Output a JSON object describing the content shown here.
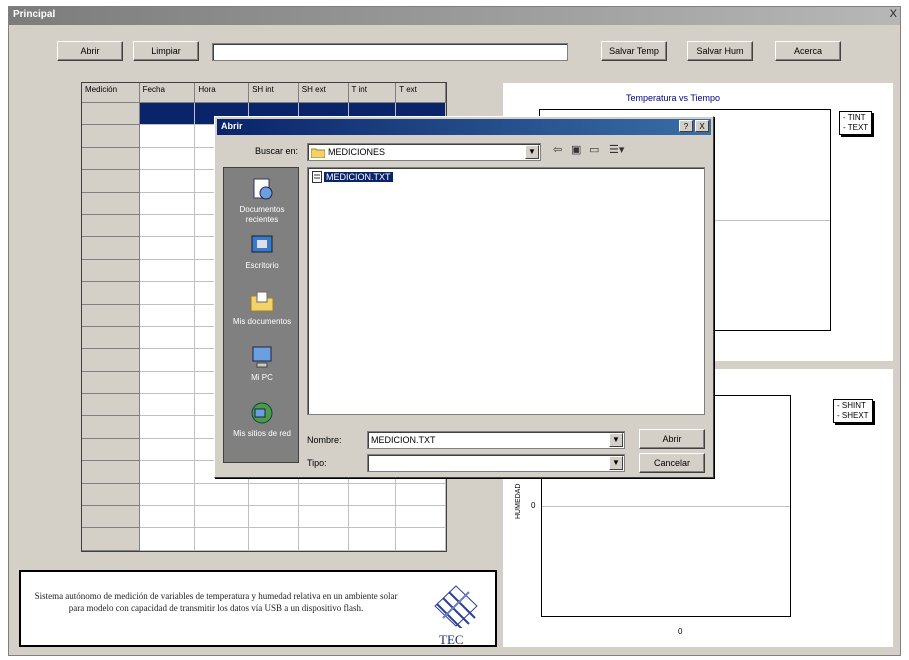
{
  "window": {
    "title": "Principal",
    "close": "X"
  },
  "toolbar": {
    "abrir": "Abrir",
    "limpiar": "Limpiar",
    "path_value": "",
    "salvar_temp": "Salvar Temp",
    "salvar_hum": "Salvar Hum",
    "acerca": "Acerca"
  },
  "table": {
    "headers": [
      "Medición",
      "Fecha",
      "Hora",
      "SH int",
      "SH ext",
      "T int",
      "T ext"
    ],
    "row_count": 20,
    "selected_row": 0
  },
  "temp_chart": {
    "title": "Temperatura vs Tiempo",
    "legend": [
      "TINT",
      "TEXT"
    ]
  },
  "hum_chart": {
    "ylabel": "HUMEDAD",
    "y_tick": "0",
    "x_tick": "0",
    "legend": [
      "SHINT",
      "SHEXT"
    ]
  },
  "description": {
    "text": "Sistema autónomo de medición de variables de temperatura y humedad relativa en un ambiente solar para modelo con capacidad de transmitir los datos vía USB a un dispositivo flash.",
    "logo_text": "TEC"
  },
  "dialog": {
    "title": "Abrir",
    "help": "?",
    "close": "X",
    "look_in_label": "Buscar en:",
    "look_in_value": "MEDICIONES",
    "places": [
      "Documentos recientes",
      "Escritorio",
      "Mis documentos",
      "Mi PC",
      "Mis sitios de red"
    ],
    "file": "MEDICION.TXT",
    "filename_label": "Nombre:",
    "filename_value": "MEDICION.TXT",
    "filetype_label": "Tipo:",
    "filetype_value": "",
    "open_btn": "Abrir",
    "cancel_btn": "Cancelar"
  },
  "colors": {
    "selection": "#0a246a",
    "title_active": "#0a246a",
    "plot_axis": "#000000"
  }
}
